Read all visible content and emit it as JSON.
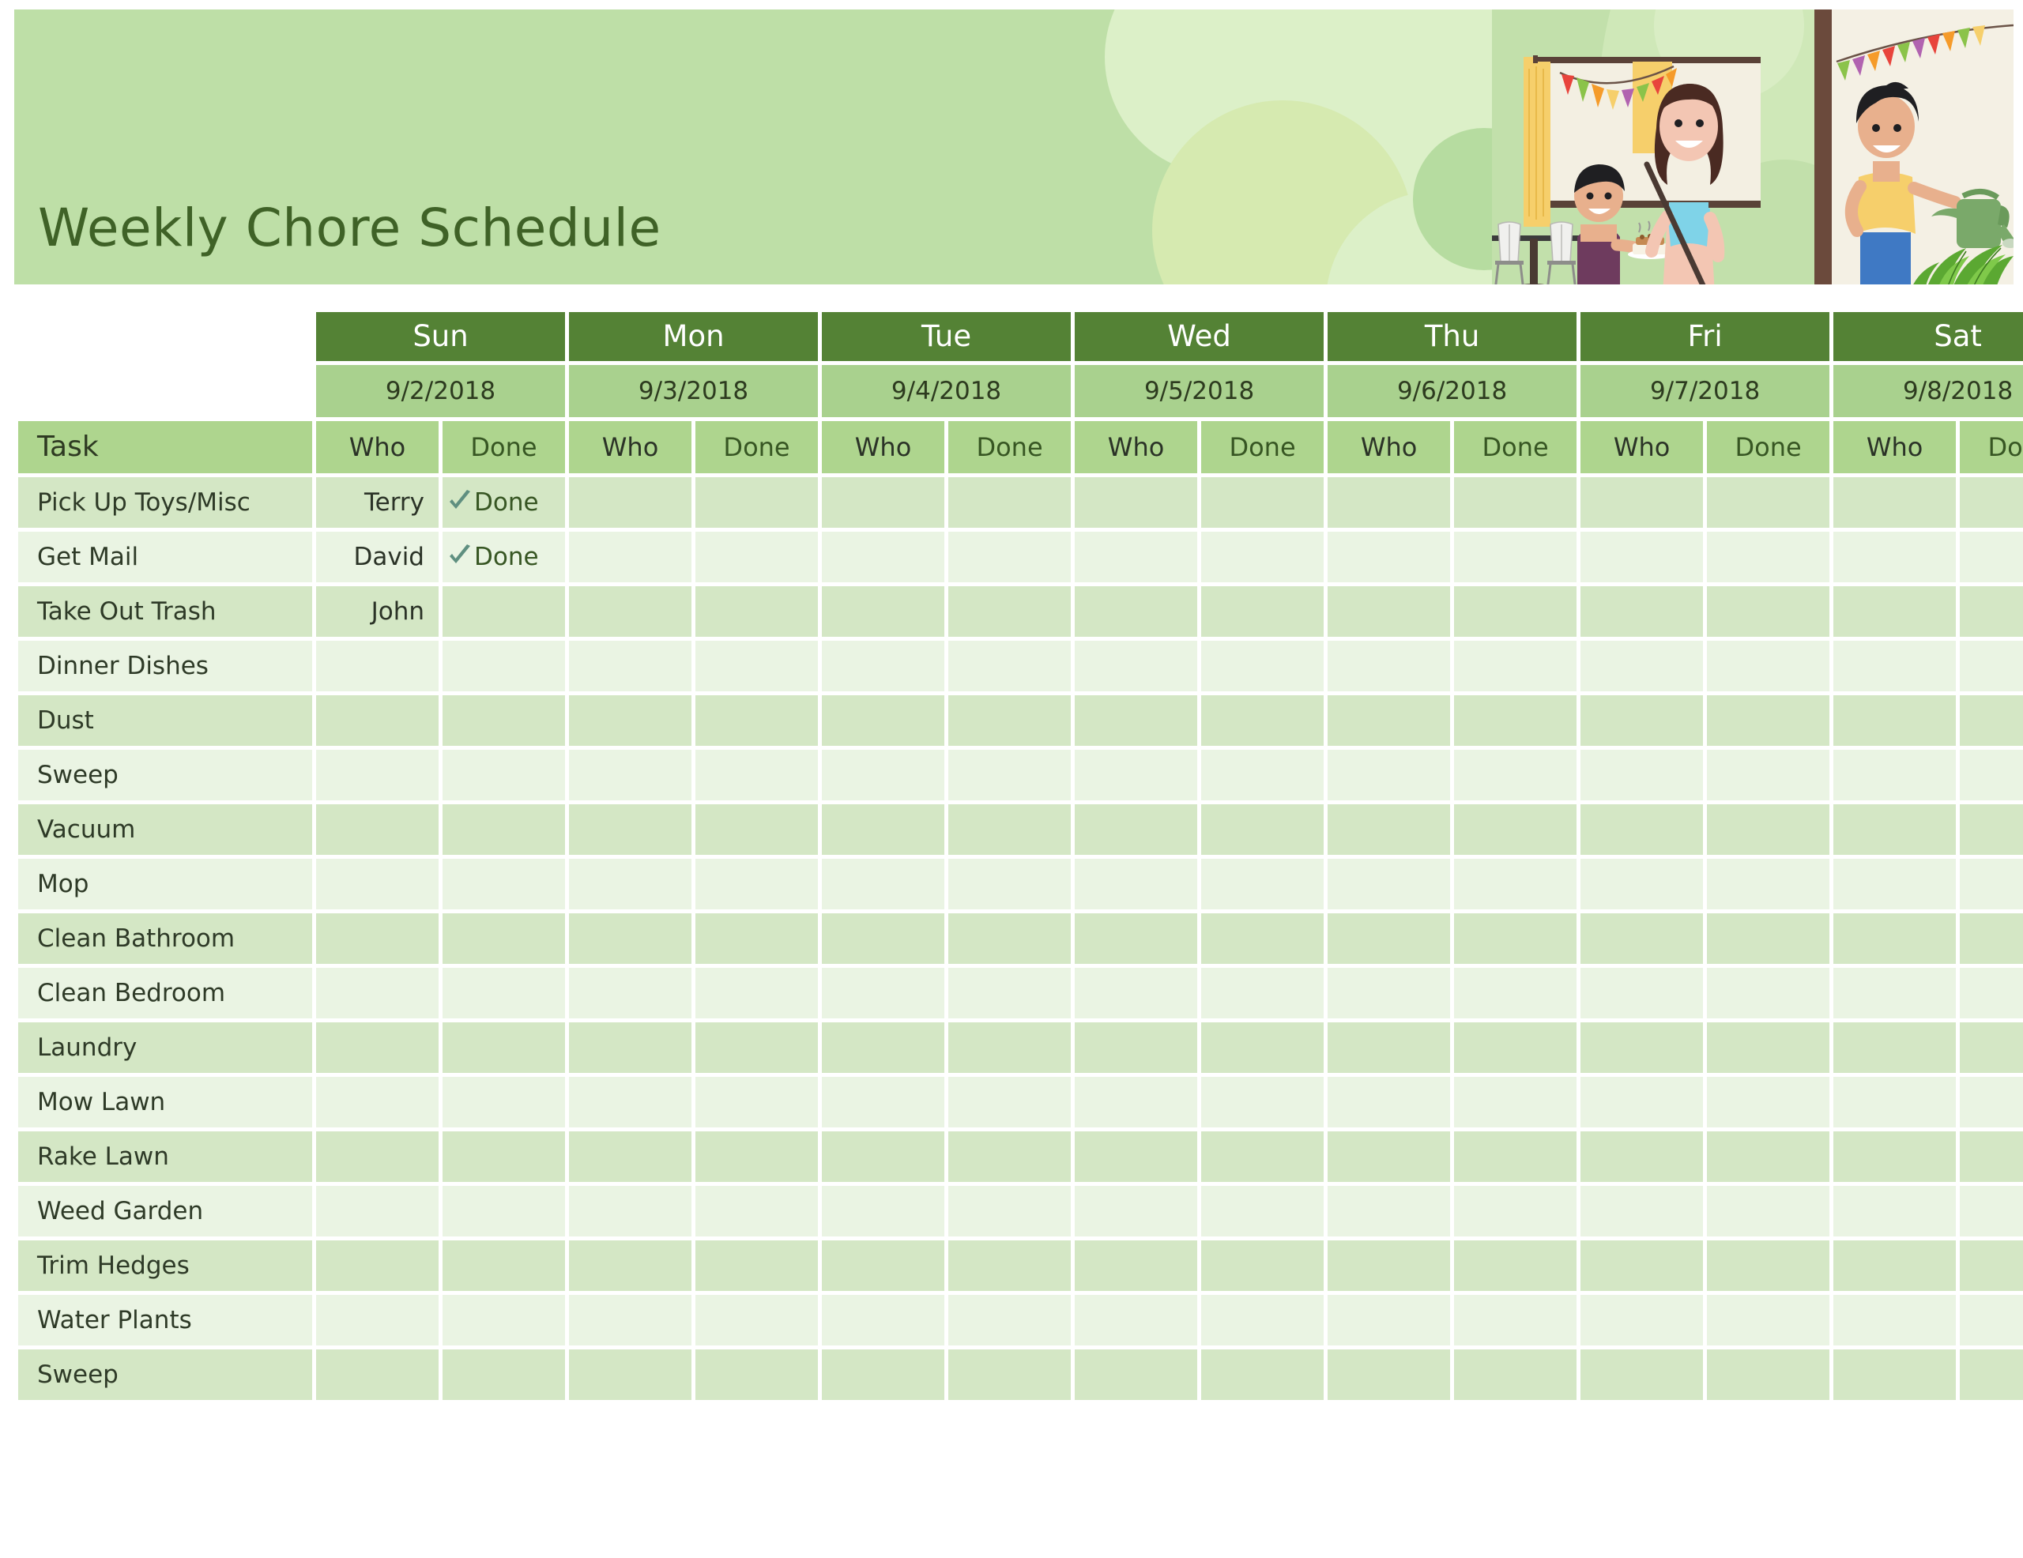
{
  "banner": {
    "title": "Weekly Chore Schedule",
    "background_color": "#bedfa7",
    "title_color": "#3f6227",
    "illustration_name": "family-doing-chores-illustration"
  },
  "theme": {
    "day_header_bg": "#548235",
    "day_header_text": "#ffffff",
    "date_row_bg": "#a9d18e",
    "column_header_bg": "#aed58e",
    "row_band_dark": "#d4e7c5",
    "row_band_light": "#eaf4e3",
    "task_text": "#2e3a27",
    "done_text": "#375623",
    "check_color": "#5f8f80"
  },
  "table": {
    "task_column_header": "Task",
    "sub_headers": {
      "who": "Who",
      "done": "Done"
    },
    "days": [
      {
        "name": "Sun",
        "date": "9/2/2018"
      },
      {
        "name": "Mon",
        "date": "9/3/2018"
      },
      {
        "name": "Tue",
        "date": "9/4/2018"
      },
      {
        "name": "Wed",
        "date": "9/5/2018"
      },
      {
        "name": "Thu",
        "date": "9/6/2018"
      },
      {
        "name": "Fri",
        "date": "9/7/2018"
      },
      {
        "name": "Sat",
        "date": "9/8/2018"
      }
    ],
    "done_marker_label": "Done",
    "rows": [
      {
        "task": "Pick Up Toys/Misc",
        "cells": [
          {
            "who": "Terry",
            "done": "Done"
          },
          {
            "who": "",
            "done": ""
          },
          {
            "who": "",
            "done": ""
          },
          {
            "who": "",
            "done": ""
          },
          {
            "who": "",
            "done": ""
          },
          {
            "who": "",
            "done": ""
          },
          {
            "who": "",
            "done": ""
          }
        ]
      },
      {
        "task": "Get Mail",
        "cells": [
          {
            "who": "David",
            "done": "Done"
          },
          {
            "who": "",
            "done": ""
          },
          {
            "who": "",
            "done": ""
          },
          {
            "who": "",
            "done": ""
          },
          {
            "who": "",
            "done": ""
          },
          {
            "who": "",
            "done": ""
          },
          {
            "who": "",
            "done": ""
          }
        ]
      },
      {
        "task": "Take Out Trash",
        "cells": [
          {
            "who": "John",
            "done": ""
          },
          {
            "who": "",
            "done": ""
          },
          {
            "who": "",
            "done": ""
          },
          {
            "who": "",
            "done": ""
          },
          {
            "who": "",
            "done": ""
          },
          {
            "who": "",
            "done": ""
          },
          {
            "who": "",
            "done": ""
          }
        ]
      },
      {
        "task": "Dinner Dishes",
        "cells": [
          {
            "who": "",
            "done": ""
          },
          {
            "who": "",
            "done": ""
          },
          {
            "who": "",
            "done": ""
          },
          {
            "who": "",
            "done": ""
          },
          {
            "who": "",
            "done": ""
          },
          {
            "who": "",
            "done": ""
          },
          {
            "who": "",
            "done": ""
          }
        ]
      },
      {
        "task": "Dust",
        "cells": [
          {
            "who": "",
            "done": ""
          },
          {
            "who": "",
            "done": ""
          },
          {
            "who": "",
            "done": ""
          },
          {
            "who": "",
            "done": ""
          },
          {
            "who": "",
            "done": ""
          },
          {
            "who": "",
            "done": ""
          },
          {
            "who": "",
            "done": ""
          }
        ]
      },
      {
        "task": "Sweep",
        "cells": [
          {
            "who": "",
            "done": ""
          },
          {
            "who": "",
            "done": ""
          },
          {
            "who": "",
            "done": ""
          },
          {
            "who": "",
            "done": ""
          },
          {
            "who": "",
            "done": ""
          },
          {
            "who": "",
            "done": ""
          },
          {
            "who": "",
            "done": ""
          }
        ]
      },
      {
        "task": "Vacuum",
        "cells": [
          {
            "who": "",
            "done": ""
          },
          {
            "who": "",
            "done": ""
          },
          {
            "who": "",
            "done": ""
          },
          {
            "who": "",
            "done": ""
          },
          {
            "who": "",
            "done": ""
          },
          {
            "who": "",
            "done": ""
          },
          {
            "who": "",
            "done": ""
          }
        ]
      },
      {
        "task": "Mop",
        "cells": [
          {
            "who": "",
            "done": ""
          },
          {
            "who": "",
            "done": ""
          },
          {
            "who": "",
            "done": ""
          },
          {
            "who": "",
            "done": ""
          },
          {
            "who": "",
            "done": ""
          },
          {
            "who": "",
            "done": ""
          },
          {
            "who": "",
            "done": ""
          }
        ]
      },
      {
        "task": "Clean Bathroom",
        "cells": [
          {
            "who": "",
            "done": ""
          },
          {
            "who": "",
            "done": ""
          },
          {
            "who": "",
            "done": ""
          },
          {
            "who": "",
            "done": ""
          },
          {
            "who": "",
            "done": ""
          },
          {
            "who": "",
            "done": ""
          },
          {
            "who": "",
            "done": ""
          }
        ]
      },
      {
        "task": "Clean Bedroom",
        "cells": [
          {
            "who": "",
            "done": ""
          },
          {
            "who": "",
            "done": ""
          },
          {
            "who": "",
            "done": ""
          },
          {
            "who": "",
            "done": ""
          },
          {
            "who": "",
            "done": ""
          },
          {
            "who": "",
            "done": ""
          },
          {
            "who": "",
            "done": ""
          }
        ]
      },
      {
        "task": "Laundry",
        "cells": [
          {
            "who": "",
            "done": ""
          },
          {
            "who": "",
            "done": ""
          },
          {
            "who": "",
            "done": ""
          },
          {
            "who": "",
            "done": ""
          },
          {
            "who": "",
            "done": ""
          },
          {
            "who": "",
            "done": ""
          },
          {
            "who": "",
            "done": ""
          }
        ]
      },
      {
        "task": "Mow Lawn",
        "cells": [
          {
            "who": "",
            "done": ""
          },
          {
            "who": "",
            "done": ""
          },
          {
            "who": "",
            "done": ""
          },
          {
            "who": "",
            "done": ""
          },
          {
            "who": "",
            "done": ""
          },
          {
            "who": "",
            "done": ""
          },
          {
            "who": "",
            "done": ""
          }
        ]
      },
      {
        "task": "Rake Lawn",
        "cells": [
          {
            "who": "",
            "done": ""
          },
          {
            "who": "",
            "done": ""
          },
          {
            "who": "",
            "done": ""
          },
          {
            "who": "",
            "done": ""
          },
          {
            "who": "",
            "done": ""
          },
          {
            "who": "",
            "done": ""
          },
          {
            "who": "",
            "done": ""
          }
        ]
      },
      {
        "task": "Weed Garden",
        "cells": [
          {
            "who": "",
            "done": ""
          },
          {
            "who": "",
            "done": ""
          },
          {
            "who": "",
            "done": ""
          },
          {
            "who": "",
            "done": ""
          },
          {
            "who": "",
            "done": ""
          },
          {
            "who": "",
            "done": ""
          },
          {
            "who": "",
            "done": ""
          }
        ]
      },
      {
        "task": "Trim Hedges",
        "cells": [
          {
            "who": "",
            "done": ""
          },
          {
            "who": "",
            "done": ""
          },
          {
            "who": "",
            "done": ""
          },
          {
            "who": "",
            "done": ""
          },
          {
            "who": "",
            "done": ""
          },
          {
            "who": "",
            "done": ""
          },
          {
            "who": "",
            "done": ""
          }
        ]
      },
      {
        "task": "Water Plants",
        "cells": [
          {
            "who": "",
            "done": ""
          },
          {
            "who": "",
            "done": ""
          },
          {
            "who": "",
            "done": ""
          },
          {
            "who": "",
            "done": ""
          },
          {
            "who": "",
            "done": ""
          },
          {
            "who": "",
            "done": ""
          },
          {
            "who": "",
            "done": ""
          }
        ]
      },
      {
        "task": "Sweep",
        "cells": [
          {
            "who": "",
            "done": ""
          },
          {
            "who": "",
            "done": ""
          },
          {
            "who": "",
            "done": ""
          },
          {
            "who": "",
            "done": ""
          },
          {
            "who": "",
            "done": ""
          },
          {
            "who": "",
            "done": ""
          },
          {
            "who": "",
            "done": ""
          }
        ]
      }
    ]
  }
}
